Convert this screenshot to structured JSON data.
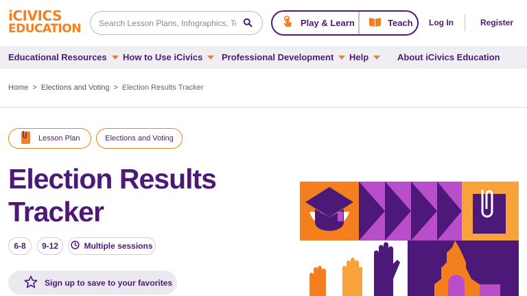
{
  "brand": {
    "logo_line1": "iCIVICS",
    "logo_line2": "EDUCATION",
    "accent": "#f47f1f",
    "primary": "#4d1979"
  },
  "search": {
    "placeholder": "Search Lesson Plans, Infographics, Topic",
    "icon": "search-icon"
  },
  "header": {
    "play_learn": "Play & Learn",
    "teach": "Teach",
    "login": "Log In",
    "register": "Register"
  },
  "nav": {
    "items": [
      {
        "label": "Educational Resources",
        "has_menu": true
      },
      {
        "label": "How to Use iCivics",
        "has_menu": true
      },
      {
        "label": "Professional Development",
        "has_menu": true
      },
      {
        "label": "Help",
        "has_menu": true
      },
      {
        "label": "About iCivics Education",
        "has_menu": false
      }
    ]
  },
  "breadcrumb": {
    "items": [
      "Home",
      "Elections and Voting"
    ],
    "current": "Election Results Tracker",
    "separator": ">"
  },
  "tags": {
    "type": "Lesson Plan",
    "topic": "Elections and Voting"
  },
  "page": {
    "title": "Election Results Tracker"
  },
  "meta": {
    "grade1": "6-8",
    "grade2": "9-12",
    "duration": "Multiple sessions"
  },
  "favorites": {
    "label": "Sign up to save to your favorites",
    "icon": "star-icon"
  }
}
